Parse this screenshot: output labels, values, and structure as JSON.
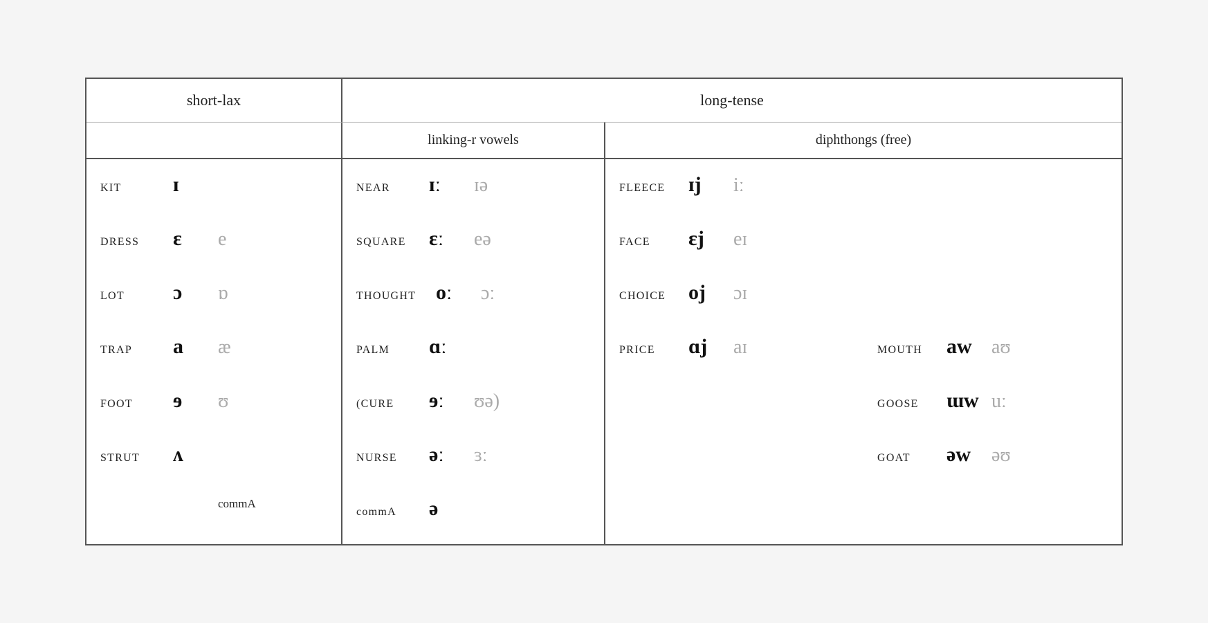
{
  "headers": {
    "short_lax": "short-lax",
    "long_tense": "long-tense",
    "linking_r": "linking-r vowels",
    "diphthongs": "diphthongs (free)"
  },
  "short_lax_rows": [
    {
      "word": "KIT",
      "sym1": "ɪ",
      "sym2": ""
    },
    {
      "word": "DRESS",
      "sym1": "ɛ",
      "sym2": "e"
    },
    {
      "word": "LOT",
      "sym1": "ɔ",
      "sym2": "ɒ"
    },
    {
      "word": "TRAP",
      "sym1": "a",
      "sym2": "æ"
    },
    {
      "word": "FOOT",
      "sym1": "ɘ",
      "sym2": "ʊ"
    },
    {
      "word": "STRUT",
      "sym1": "ʌ",
      "sym2": ""
    },
    {
      "word": "",
      "sym1": "",
      "sym2": ""
    }
  ],
  "linking_r_rows": [
    {
      "word": "NEAR",
      "sym1": "ɪː",
      "sym2": "ɪə"
    },
    {
      "word": "SQUARE",
      "sym1": "ɛː",
      "sym2": "eə"
    },
    {
      "word": "THOUGHT",
      "sym1": "oː",
      "sym2": "ɔː"
    },
    {
      "word": "PALM",
      "sym1": "ɑː",
      "sym2": ""
    },
    {
      "word": "(CURE",
      "sym1": "ɘː",
      "sym2": "ʊə)"
    },
    {
      "word": "NURSE",
      "sym1": "əː",
      "sym2": "ɜː"
    },
    {
      "word": "commA",
      "sym1": "ə",
      "sym2": ""
    }
  ],
  "diphthong_rows": [
    {
      "word1": "FLEECE",
      "sym1a": "ɪj",
      "sym1b": "iː",
      "word2": "",
      "sym2a": "",
      "sym2b": ""
    },
    {
      "word1": "FACE",
      "sym1a": "ɛj",
      "sym1b": "eɪ",
      "word2": "",
      "sym2a": "",
      "sym2b": ""
    },
    {
      "word1": "CHOICE",
      "sym1a": "oj",
      "sym1b": "ɔɪ",
      "word2": "",
      "sym2a": "",
      "sym2b": ""
    },
    {
      "word1": "PRICE",
      "sym1a": "ɑj",
      "sym1b": "aɪ",
      "word2": "MOUTH",
      "sym2a": "aw",
      "sym2b": "aʊ"
    },
    {
      "word1": "",
      "sym1a": "",
      "sym1b": "",
      "word2": "GOOSE",
      "sym2a": "ɯw",
      "sym2b": "uː"
    },
    {
      "word1": "",
      "sym1a": "",
      "sym1b": "",
      "word2": "GOAT",
      "sym2a": "əw",
      "sym2b": "əʊ"
    },
    {
      "word1": "",
      "sym1a": "",
      "sym1b": "",
      "word2": "",
      "sym2a": "",
      "sym2b": ""
    }
  ]
}
